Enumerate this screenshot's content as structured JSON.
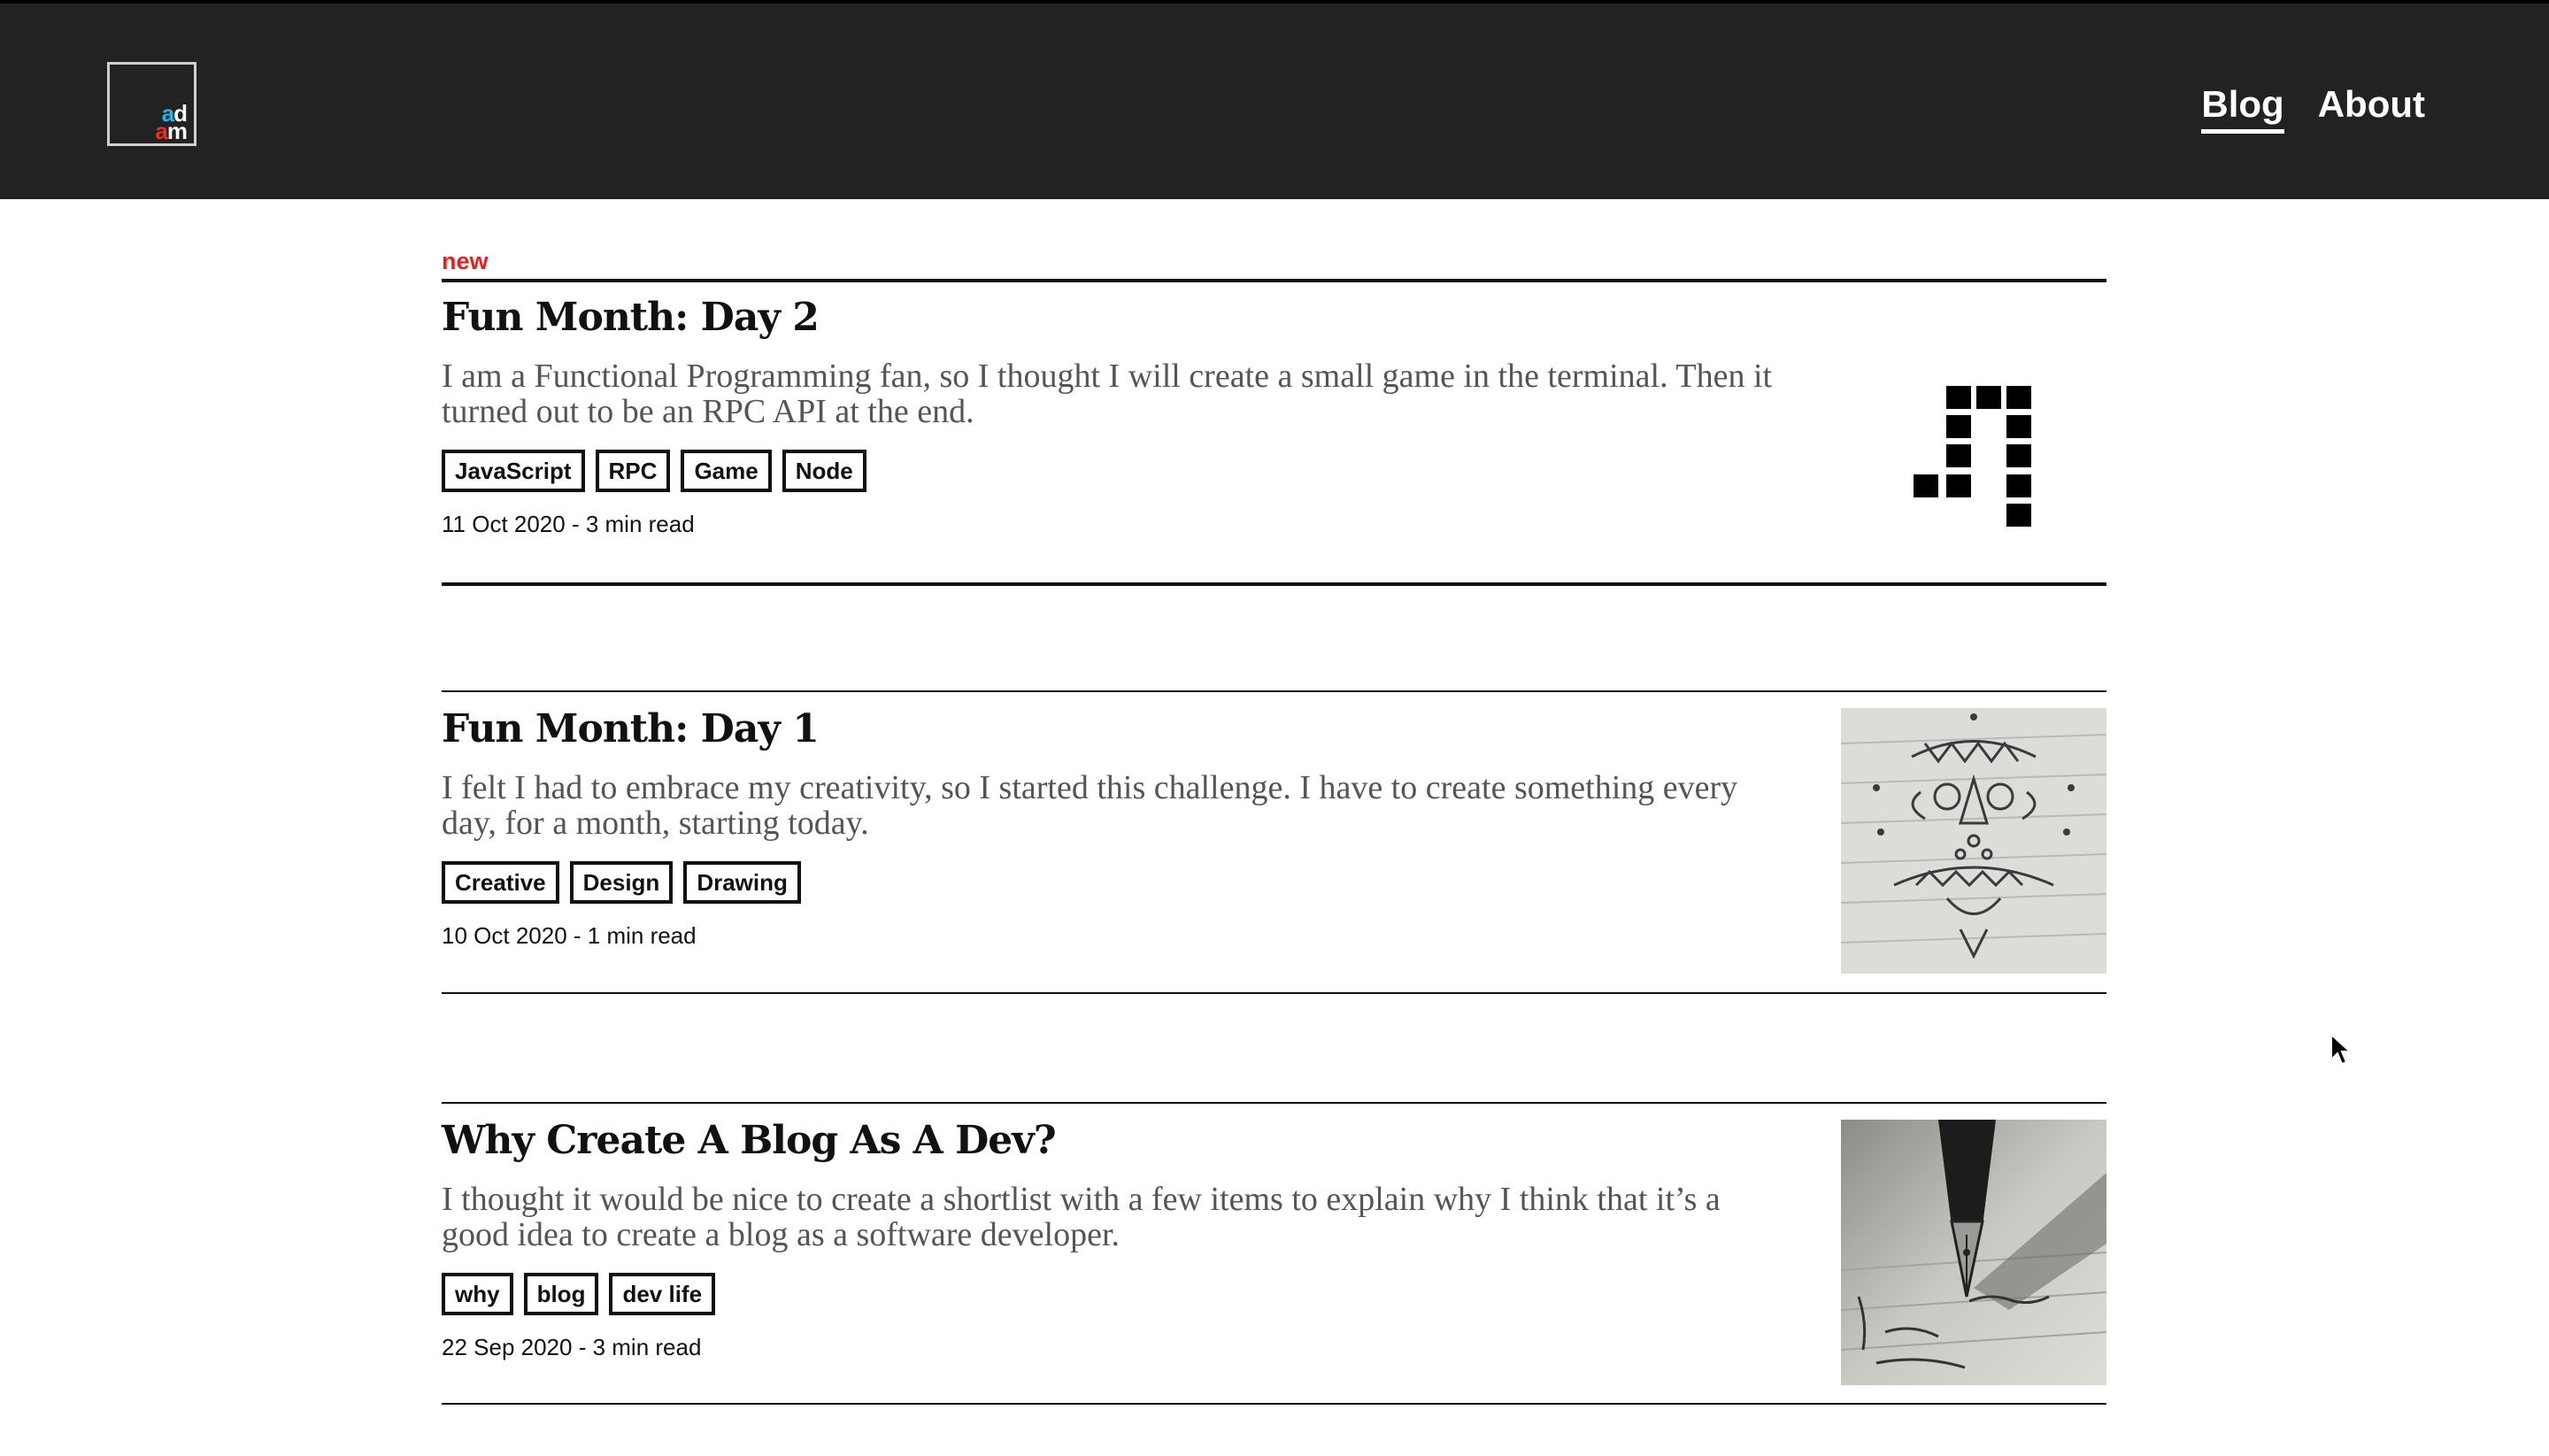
{
  "header": {
    "logo": {
      "line1_a": "a",
      "line1_b": "d",
      "line2_a": "a",
      "line2_b": "m"
    },
    "nav": [
      {
        "label": "Blog",
        "active": true
      },
      {
        "label": "About",
        "active": false
      }
    ]
  },
  "posts": [
    {
      "badge": "new",
      "title": "Fun Month: Day 2",
      "excerpt": "I am a Functional Programming fan, so I thought I will create a small game in the terminal. Then it turned out to be an RPC API at the end.",
      "tags": [
        "JavaScript",
        "RPC",
        "Game",
        "Node"
      ],
      "date": "11 Oct 2020",
      "separator": " - ",
      "read_time": "3 min read",
      "image": "pixel-number-icon"
    },
    {
      "title": "Fun Month: Day 1",
      "excerpt": "I felt I had to embrace my creativity, so I started this challenge. I have to create something every day, for a month, starting today.",
      "tags": [
        "Creative",
        "Design",
        "Drawing"
      ],
      "date": "10 Oct 2020",
      "separator": " - ",
      "read_time": "1 min read",
      "image": "doodle-drawing-photo"
    },
    {
      "title": "Why Create A Blog As A Dev?",
      "excerpt": "I thought it would be nice to create a shortlist with a few items to explain why I think that it’s a good idea to create a blog as a software developer.",
      "tags": [
        "why",
        "blog",
        "dev life"
      ],
      "date": "22 Sep 2020",
      "separator": " - ",
      "read_time": "3 min read",
      "image": "fountain-pen-photo"
    }
  ],
  "colors": {
    "header_bg": "#222222",
    "accent_red": "#e91f1f",
    "logo_blue": "#1fb6e8"
  }
}
